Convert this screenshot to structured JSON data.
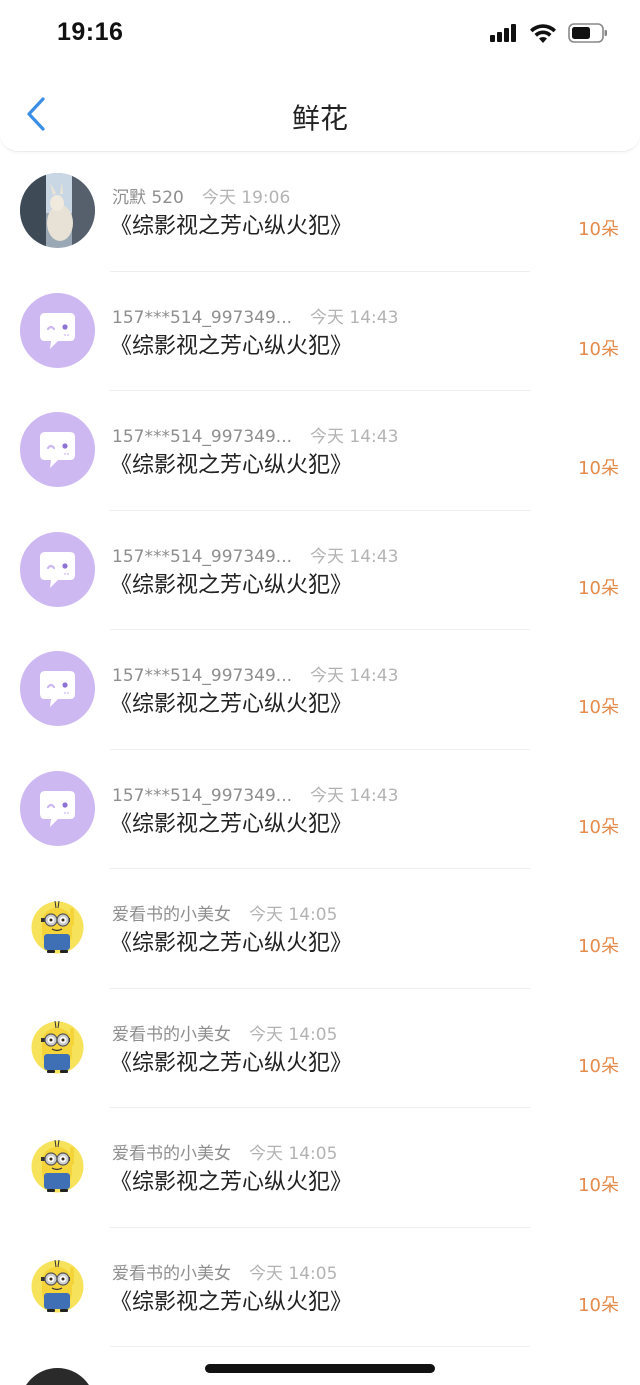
{
  "status_bar": {
    "time": "19:16"
  },
  "nav": {
    "title": "鲜花"
  },
  "rows": [
    {
      "avatar": "photo",
      "name": "沉默 520",
      "time": "今天 19:06",
      "book": "《综影视之芳心纵火犯》",
      "count": "10朵"
    },
    {
      "avatar": "chat",
      "name": "157***514_997349...",
      "time": "今天 14:43",
      "book": "《综影视之芳心纵火犯》",
      "count": "10朵"
    },
    {
      "avatar": "chat",
      "name": "157***514_997349...",
      "time": "今天 14:43",
      "book": "《综影视之芳心纵火犯》",
      "count": "10朵"
    },
    {
      "avatar": "chat",
      "name": "157***514_997349...",
      "time": "今天 14:43",
      "book": "《综影视之芳心纵火犯》",
      "count": "10朵"
    },
    {
      "avatar": "chat",
      "name": "157***514_997349...",
      "time": "今天 14:43",
      "book": "《综影视之芳心纵火犯》",
      "count": "10朵"
    },
    {
      "avatar": "chat",
      "name": "157***514_997349...",
      "time": "今天 14:43",
      "book": "《综影视之芳心纵火犯》",
      "count": "10朵"
    },
    {
      "avatar": "minion",
      "name": "爱看书的小美女",
      "time": "今天 14:05",
      "book": "《综影视之芳心纵火犯》",
      "count": "10朵"
    },
    {
      "avatar": "minion",
      "name": "爱看书的小美女",
      "time": "今天 14:05",
      "book": "《综影视之芳心纵火犯》",
      "count": "10朵"
    },
    {
      "avatar": "minion",
      "name": "爱看书的小美女",
      "time": "今天 14:05",
      "book": "《综影视之芳心纵火犯》",
      "count": "10朵"
    },
    {
      "avatar": "minion",
      "name": "爱看书的小美女",
      "time": "今天 14:05",
      "book": "《综影视之芳心纵火犯》",
      "count": "10朵"
    }
  ],
  "colors": {
    "accent": "#3a8ee6",
    "count": "#e48b4c",
    "chat_avatar_bg": "#cdb8f2"
  },
  "icons": {
    "back": "chevron-left-icon",
    "signal": "signal-icon",
    "wifi": "wifi-icon",
    "battery": "battery-icon"
  }
}
